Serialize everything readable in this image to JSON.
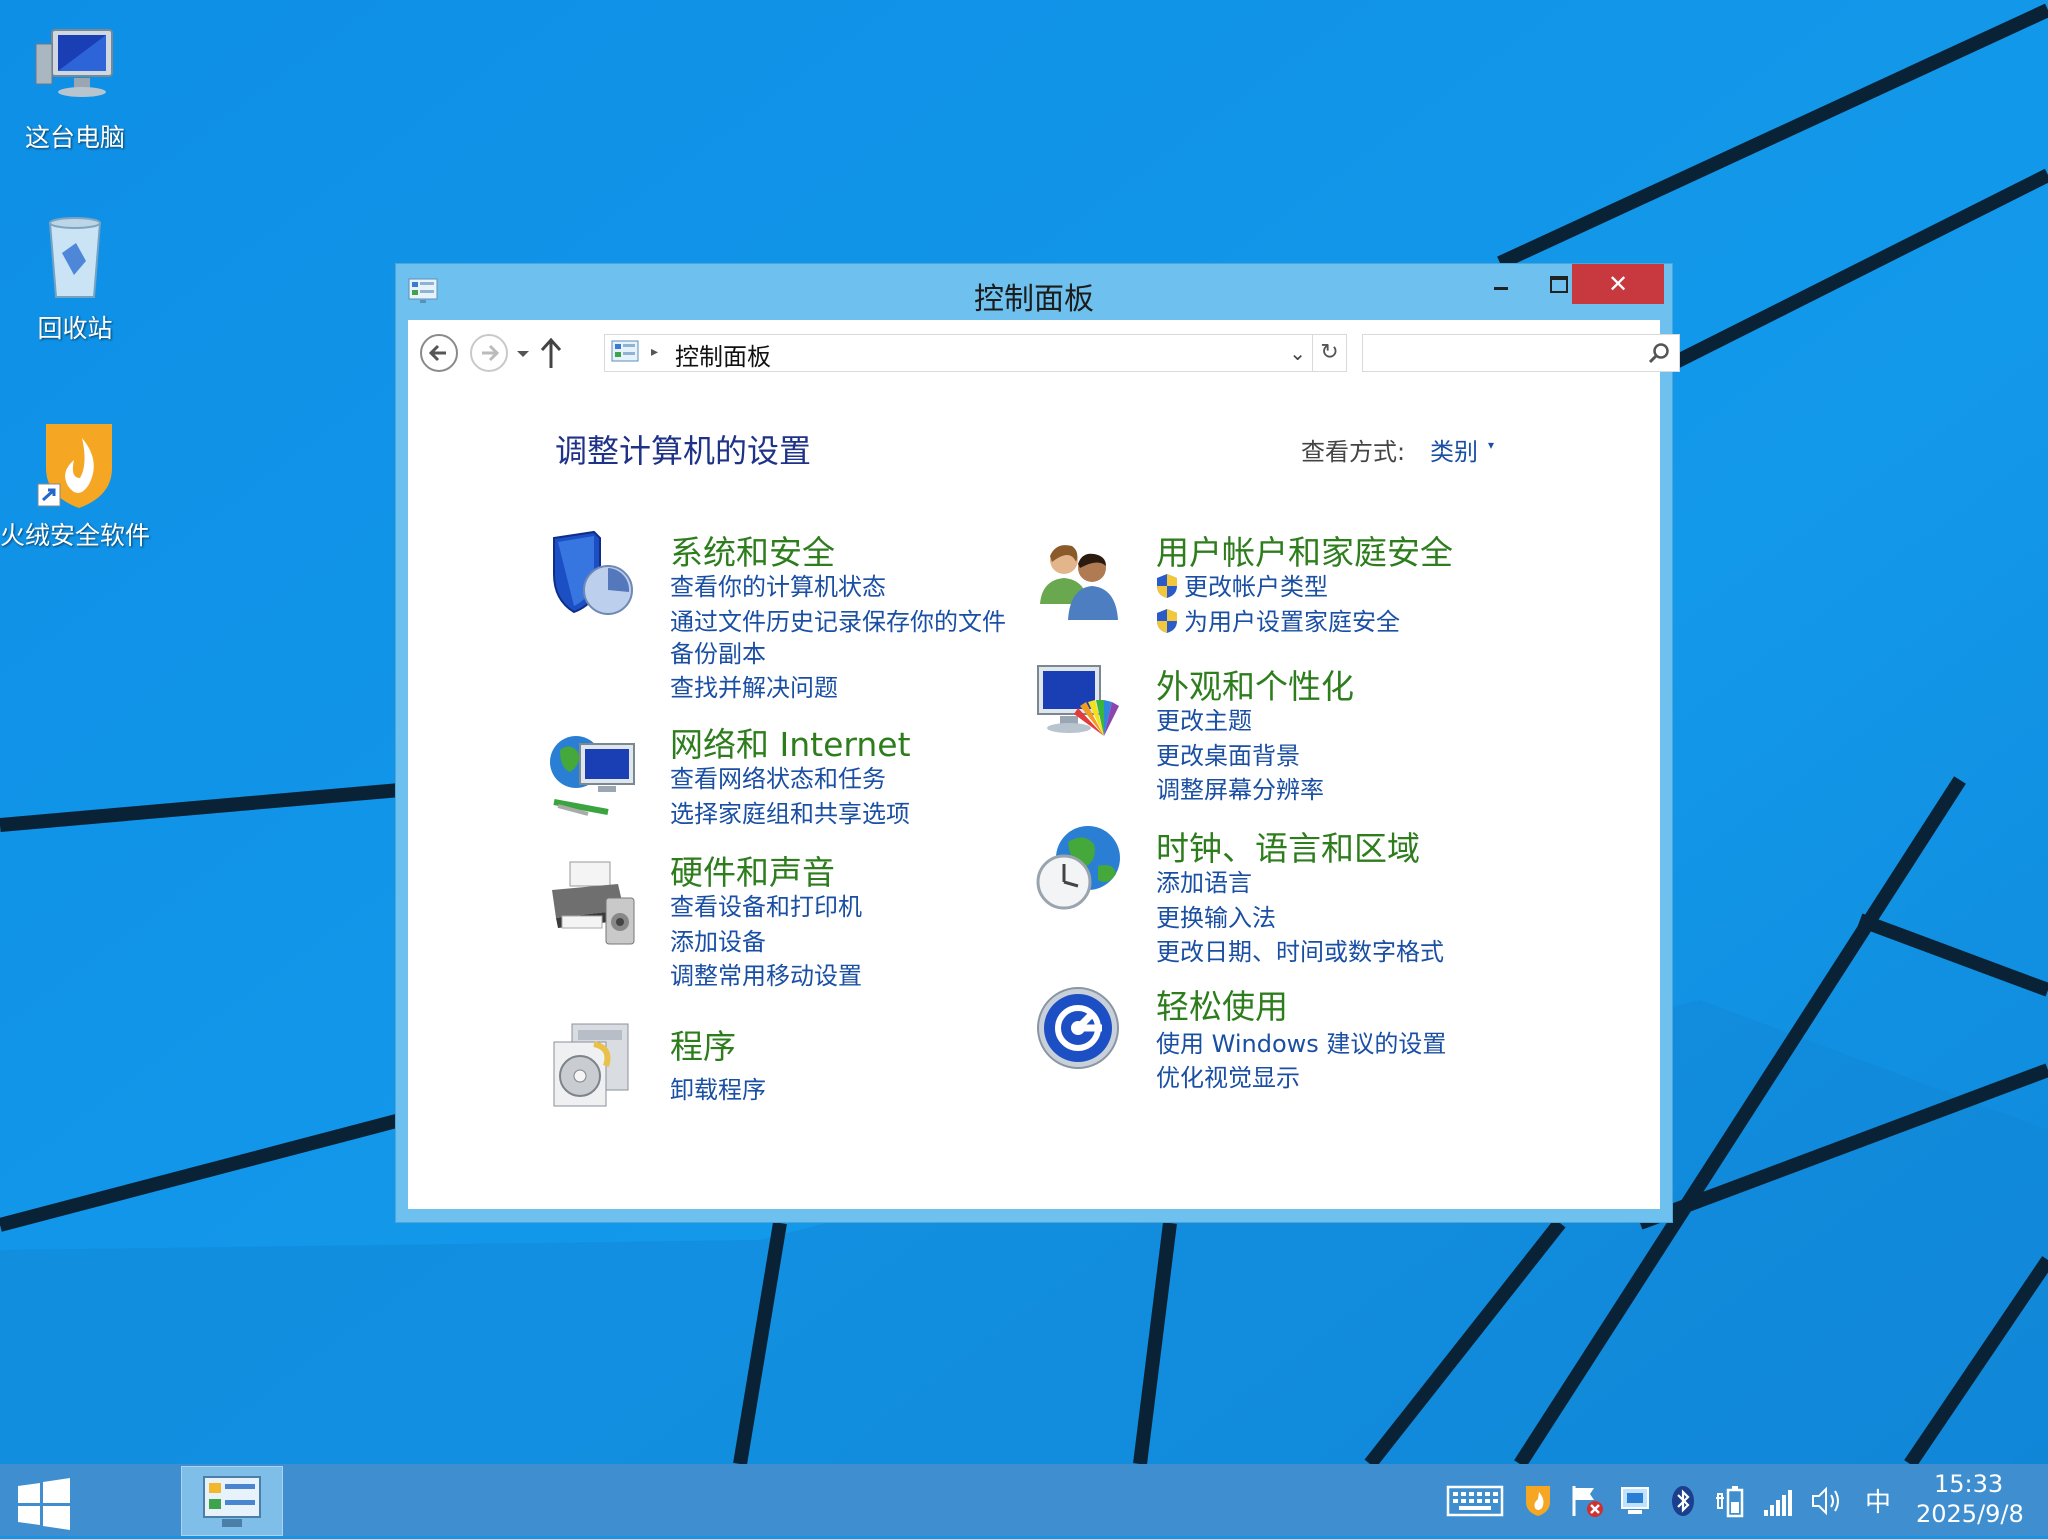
{
  "desktop": {
    "icons": [
      {
        "label": "这台电脑"
      },
      {
        "label": "回收站"
      },
      {
        "label": "火绒安全软件"
      }
    ]
  },
  "window": {
    "title": "控制面板",
    "close_glyph": "✕",
    "address": {
      "path": "控制面板",
      "separator": "▸",
      "dropdown": "⌄",
      "refresh": "↻"
    },
    "search": {
      "placeholder": ""
    },
    "heading": "调整计算机的设置",
    "view_by": {
      "label": "查看方式:",
      "value": "类别",
      "arrow": "▾"
    },
    "categories_left": [
      {
        "title": "系统和安全",
        "icon": "shield-icon",
        "links": [
          "查看你的计算机状态",
          "通过文件历史记录保存你的文件",
          "备份副本",
          "查找并解决问题"
        ]
      },
      {
        "title": "网络和 Internet",
        "icon": "network-icon",
        "links": [
          "查看网络状态和任务",
          "选择家庭组和共享选项"
        ]
      },
      {
        "title": "硬件和声音",
        "icon": "printer-icon",
        "links": [
          "查看设备和打印机",
          "添加设备",
          "调整常用移动设置"
        ]
      },
      {
        "title": "程序",
        "icon": "programs-icon",
        "links": [
          "卸载程序"
        ]
      }
    ],
    "categories_right": [
      {
        "title": "用户帐户和家庭安全",
        "icon": "users-icon",
        "links": [
          "更改帐户类型",
          "为用户设置家庭安全"
        ]
      },
      {
        "title": "外观和个性化",
        "icon": "monitor-palette-icon",
        "links": [
          "更改主题",
          "更改桌面背景",
          "调整屏幕分辨率"
        ]
      },
      {
        "title": "时钟、语言和区域",
        "icon": "clock-globe-icon",
        "links": [
          "添加语言",
          "更换输入法",
          "更改日期、时间或数字格式"
        ]
      },
      {
        "title": "轻松使用",
        "icon": "ease-of-access-icon",
        "links": [
          "使用 Windows 建议的设置",
          "优化视觉显示"
        ]
      }
    ]
  },
  "taskbar": {
    "ime": "中",
    "time": "15:33",
    "date": "2025/9/8"
  },
  "colors": {
    "desktop": "#1296e8",
    "window_frame": "#6ec1ee",
    "close_button": "#c7383f",
    "category_title": "#2e7d1d",
    "link": "#1a4fa3",
    "heading": "#1e3287",
    "taskbar": "#3f8fd0"
  }
}
